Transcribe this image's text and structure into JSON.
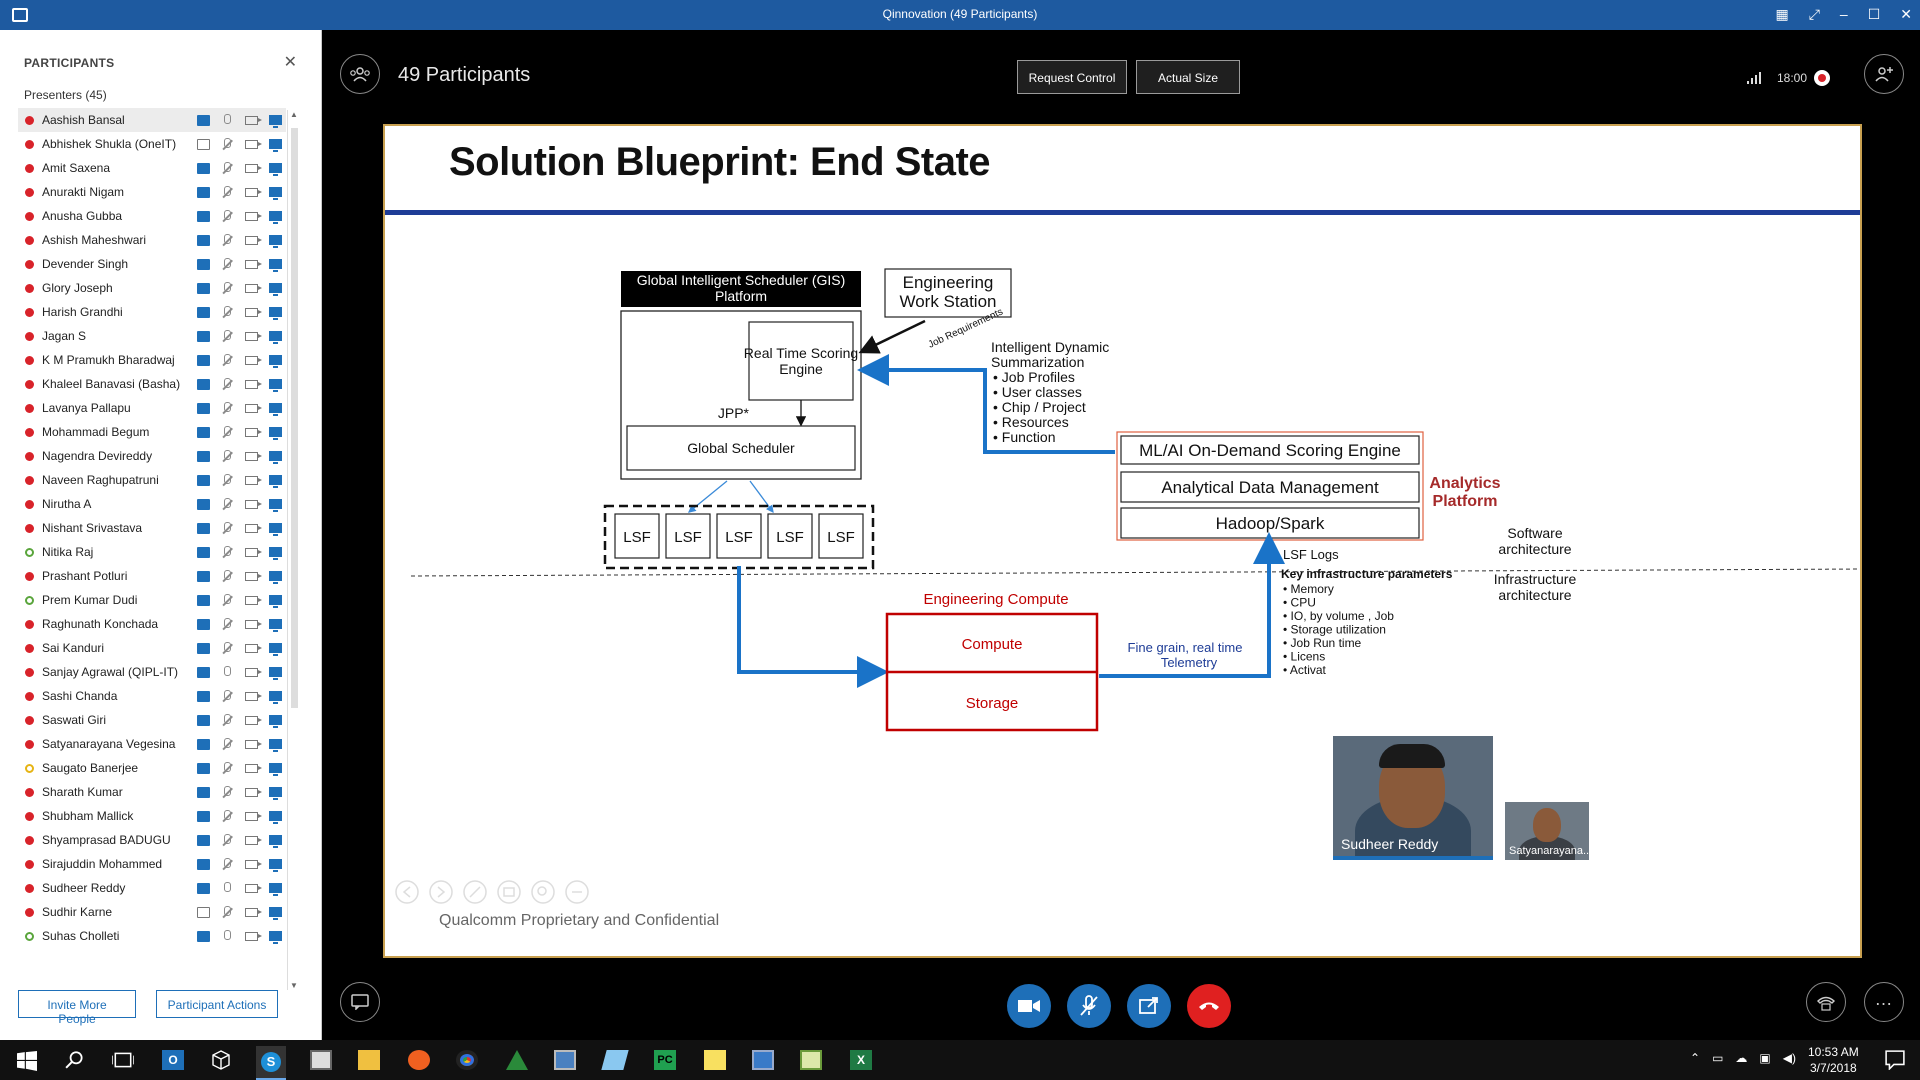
{
  "window": {
    "title": "Qinnovation (49 Participants)"
  },
  "participants_panel": {
    "title": "PARTICIPANTS",
    "group": "Presenters (45)",
    "invite_label": "Invite More People",
    "actions_label": "Participant Actions",
    "items": [
      {
        "name": "Aashish Bansal",
        "status": "red",
        "chat": "on",
        "mic": "on",
        "screen": "on"
      },
      {
        "name": "Abhishek Shukla (OneIT)",
        "status": "red",
        "chat": "off",
        "mic": "off",
        "screen": "on"
      },
      {
        "name": "Amit Saxena",
        "status": "red",
        "chat": "on",
        "mic": "off",
        "screen": "on"
      },
      {
        "name": "Anurakti Nigam",
        "status": "red",
        "chat": "on",
        "mic": "off",
        "screen": "on"
      },
      {
        "name": "Anusha Gubba",
        "status": "red",
        "chat": "on",
        "mic": "off",
        "screen": "on"
      },
      {
        "name": "Ashish Maheshwari",
        "status": "red",
        "chat": "on",
        "mic": "off",
        "screen": "on"
      },
      {
        "name": "Devender Singh",
        "status": "red",
        "chat": "on",
        "mic": "off",
        "screen": "on"
      },
      {
        "name": "Glory Joseph",
        "status": "red",
        "chat": "on",
        "mic": "off",
        "screen": "on"
      },
      {
        "name": "Harish Grandhi",
        "status": "red",
        "chat": "on",
        "mic": "off",
        "screen": "on"
      },
      {
        "name": "Jagan S",
        "status": "red",
        "chat": "on",
        "mic": "off",
        "screen": "on"
      },
      {
        "name": "K M Pramukh Bharadwaj",
        "status": "red",
        "chat": "on",
        "mic": "off",
        "screen": "on"
      },
      {
        "name": "Khaleel Banavasi (Basha)",
        "status": "red",
        "chat": "on",
        "mic": "off",
        "screen": "on"
      },
      {
        "name": "Lavanya Pallapu",
        "status": "red",
        "chat": "on",
        "mic": "off",
        "screen": "on"
      },
      {
        "name": "Mohammadi Begum",
        "status": "red",
        "chat": "on",
        "mic": "off",
        "screen": "on"
      },
      {
        "name": "Nagendra Devireddy",
        "status": "red",
        "chat": "on",
        "mic": "off",
        "screen": "on"
      },
      {
        "name": "Naveen Raghupatruni",
        "status": "red",
        "chat": "on",
        "mic": "off",
        "screen": "on"
      },
      {
        "name": "Nirutha A",
        "status": "red",
        "chat": "on",
        "mic": "off",
        "screen": "on"
      },
      {
        "name": "Nishant Srivastava",
        "status": "red",
        "chat": "on",
        "mic": "off",
        "screen": "on"
      },
      {
        "name": "Nitika Raj",
        "status": "green",
        "chat": "on",
        "mic": "off",
        "screen": "on"
      },
      {
        "name": "Prashant Potluri",
        "status": "red",
        "chat": "on",
        "mic": "off",
        "screen": "on"
      },
      {
        "name": "Prem Kumar Dudi",
        "status": "green",
        "chat": "on",
        "mic": "off",
        "screen": "on"
      },
      {
        "name": "Raghunath Konchada",
        "status": "red",
        "chat": "on",
        "mic": "off",
        "screen": "on"
      },
      {
        "name": "Sai Kanduri",
        "status": "red",
        "chat": "on",
        "mic": "off",
        "screen": "on"
      },
      {
        "name": "Sanjay Agrawal (QIPL-IT)",
        "status": "red",
        "chat": "on",
        "mic": "on",
        "screen": "on"
      },
      {
        "name": "Sashi Chanda",
        "status": "red",
        "chat": "on",
        "mic": "off",
        "screen": "on"
      },
      {
        "name": "Saswati Giri",
        "status": "red",
        "chat": "on",
        "mic": "off",
        "screen": "on"
      },
      {
        "name": "Satyanarayana Vegesina",
        "status": "red",
        "chat": "on",
        "mic": "off",
        "screen": "on"
      },
      {
        "name": "Saugato Banerjee",
        "status": "yellow",
        "chat": "on",
        "mic": "off",
        "screen": "on"
      },
      {
        "name": "Sharath Kumar",
        "status": "red",
        "chat": "on",
        "mic": "off",
        "screen": "on"
      },
      {
        "name": "Shubham Mallick",
        "status": "red",
        "chat": "on",
        "mic": "off",
        "screen": "on"
      },
      {
        "name": "Shyamprasad BADUGU",
        "status": "red",
        "chat": "on",
        "mic": "off",
        "screen": "on"
      },
      {
        "name": "Sirajuddin Mohammed",
        "status": "red",
        "chat": "on",
        "mic": "off",
        "screen": "on"
      },
      {
        "name": "Sudheer Reddy",
        "status": "red",
        "chat": "on",
        "mic": "on",
        "screen": "on"
      },
      {
        "name": "Sudhir Karne",
        "status": "red",
        "chat": "off",
        "mic": "off",
        "screen": "on"
      },
      {
        "name": "Suhas Cholleti",
        "status": "green",
        "chat": "on",
        "mic": "on",
        "screen": "on"
      }
    ]
  },
  "stage": {
    "participants_label": "49 Participants",
    "request_control_label": "Request Control",
    "actual_size_label": "Actual Size",
    "time": "18:00"
  },
  "slide": {
    "title": "Solution Blueprint:  End State",
    "footer": "Qualcomm Proprietary and Confidential",
    "gis_header_line1": "Global Intelligent Scheduler (GIS)",
    "gis_header_line2": "Platform",
    "ews_line1": "Engineering",
    "ews_line2": "Work Station",
    "job_requirements": "Job Requirements",
    "rtse_line1": "Real Time Scoring",
    "rtse_line2": "Engine",
    "jpp": "JPP*",
    "global_scheduler": "Global Scheduler",
    "lsf": [
      "LSF",
      "LSF",
      "LSF",
      "LSF",
      "LSF"
    ],
    "summary_title1": "Intelligent Dynamic",
    "summary_title2": "Summarization",
    "summary_items": [
      "Job Profiles",
      "User classes",
      "Chip / Project",
      "Resources",
      "Function"
    ],
    "ml_engine": "ML/AI On-Demand Scoring Engine",
    "adm": "Analytical Data Management",
    "hadoop": "Hadoop/Spark",
    "analytics_line1": "Analytics",
    "analytics_line2": "Platform",
    "software_line1": "Software",
    "software_line2": "architecture",
    "infra_line1": "Infrastructure",
    "infra_line2": "architecture",
    "lsf_logs": "LSF Logs",
    "key_params_title": "Key infrastructure parameters",
    "key_params": [
      "Memory",
      "CPU",
      "IO, by volume , Job",
      "Storage utilization",
      "Job Run time",
      "Licens",
      "Activat"
    ],
    "eng_compute": "Engineering Compute",
    "compute": "Compute",
    "storage": "Storage",
    "telemetry_line1": "Fine grain, real time",
    "telemetry_line2": "Telemetry"
  },
  "video": {
    "main_name": "Sudheer Reddy",
    "small_name": "Satyanarayana..."
  },
  "taskbar": {
    "clock_time": "10:53 AM",
    "clock_date": "3/7/2018"
  },
  "colors": {
    "titlebar": "#1e5aa0",
    "accent_blue": "#1e6fb8",
    "presence_red": "#d8232a",
    "presence_green": "#5aa53c",
    "hangup_red": "#e02020",
    "slide_red": "#c00000",
    "arrow_blue": "#1a73c8"
  }
}
